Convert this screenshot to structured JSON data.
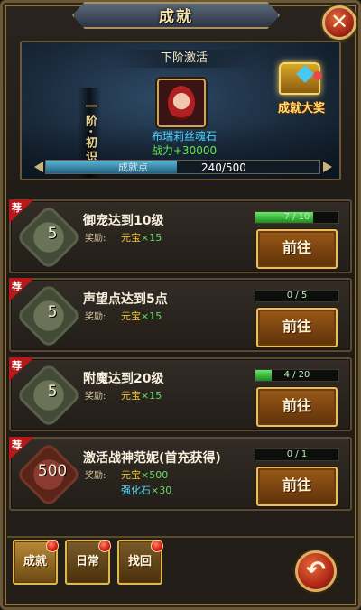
{
  "title": "成就",
  "close_icon": "✕",
  "top": {
    "next_label": "下阶激活",
    "stage": "一阶·初识",
    "soul_name": "布瑞莉丝魂石",
    "soul_power": "战力+30000",
    "chest_label": "成就大奖",
    "progress_label": "成就点",
    "progress_text": "240/500",
    "progress_value": 0.48
  },
  "tasks": [
    {
      "badge": "荐",
      "medal": "5",
      "title": "御宠达到10级",
      "reward_label": "奖励:",
      "reward1_name": "元宝",
      "reward1_qty": "×15",
      "reward2_name": "",
      "reward2_qty": "",
      "progress_text": "7 / 10",
      "progress_value": 0.7,
      "button": "前往"
    },
    {
      "badge": "荐",
      "medal": "5",
      "title": "声望点达到5点",
      "reward_label": "奖励:",
      "reward1_name": "元宝",
      "reward1_qty": "×15",
      "reward2_name": "",
      "reward2_qty": "",
      "progress_text": "0 / 5",
      "progress_value": 0,
      "button": "前往"
    },
    {
      "badge": "荐",
      "medal": "5",
      "title": "附魔达到20级",
      "reward_label": "奖励:",
      "reward1_name": "元宝",
      "reward1_qty": "×15",
      "reward2_name": "",
      "reward2_qty": "",
      "progress_text": "4 / 20",
      "progress_value": 0.2,
      "button": "前往"
    },
    {
      "badge": "荐",
      "medal": "500",
      "title": "激活战神范妮(首充获得)",
      "reward_label": "奖励:",
      "reward1_name": "元宝",
      "reward1_qty": "×500",
      "reward2_name": "强化石",
      "reward2_qty": "×30",
      "progress_text": "0 / 1",
      "progress_value": 0,
      "button": "前往"
    }
  ],
  "bottom_tabs": [
    "成就",
    "日常",
    "找回"
  ],
  "back_icon": "↶"
}
